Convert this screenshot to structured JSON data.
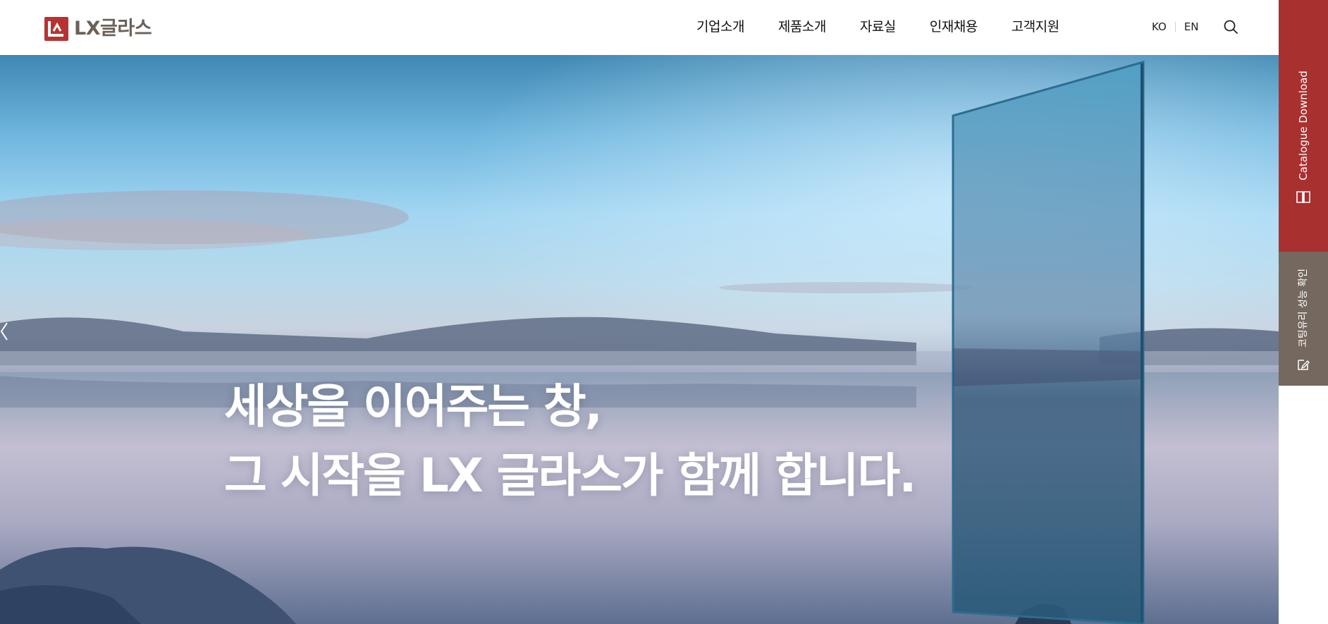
{
  "header": {
    "logo_text": "LX글라스",
    "brand_color": "#b83232",
    "nav": [
      {
        "label": "기업소개"
      },
      {
        "label": "제품소개"
      },
      {
        "label": "자료실"
      },
      {
        "label": "인재채용"
      },
      {
        "label": "고객지원"
      }
    ],
    "languages": [
      "KO",
      "EN"
    ],
    "search_icon": "search-icon"
  },
  "hero": {
    "headline_line1": "세상을 이어주는 창,",
    "headline_line2": "그 시작을 LX 글라스가 함께 합니다.",
    "prev_icon": "chevron-left-icon"
  },
  "side_tabs": {
    "catalogue": {
      "label": "Catalogue Download",
      "icon": "book-icon",
      "color": "#a8302f"
    },
    "coating": {
      "label": "코팅유리 성능 확인",
      "icon": "edit-icon",
      "color": "#74685f"
    }
  }
}
